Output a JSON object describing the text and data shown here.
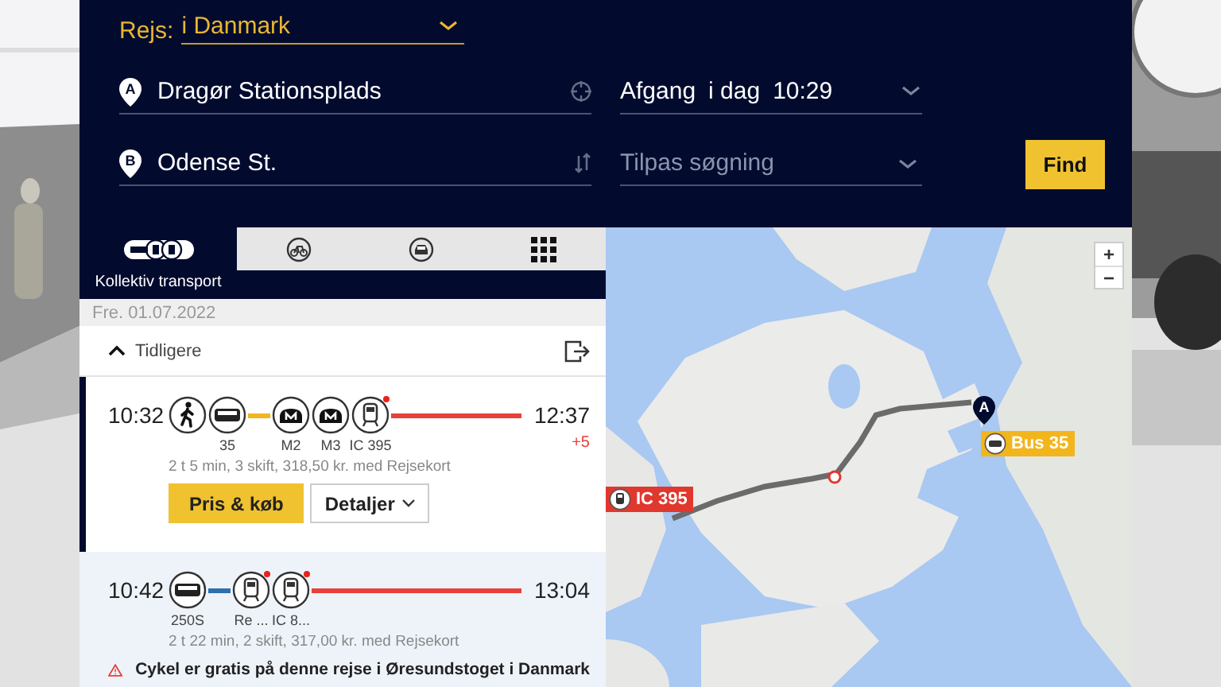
{
  "trip_type": {
    "label": "Rejs:",
    "value": "i Danmark"
  },
  "from": {
    "marker": "A",
    "value": "Dragør Stationsplads"
  },
  "to": {
    "marker": "B",
    "value": "Odense St."
  },
  "departure": {
    "mode": "Afgang",
    "day": "i dag",
    "time": "10:29"
  },
  "customize": {
    "placeholder": "Tilpas søgning"
  },
  "find_button": "Find",
  "tabs": [
    {
      "kind": "transit",
      "label": "Kollektiv transport",
      "selected": true
    },
    {
      "kind": "bike",
      "selected": false
    },
    {
      "kind": "car",
      "selected": false
    },
    {
      "kind": "more",
      "selected": false
    }
  ],
  "date": "Fre. 01.07.2022",
  "earlier": "Tidligere",
  "journeys": [
    {
      "selected": true,
      "depart": "10:32",
      "arrive": "12:37",
      "delay": "+5",
      "summary": "2 t 5 min, 3 skift, 318,50 kr. med Rejsekort",
      "legs": [
        {
          "kind": "walk",
          "alert": false
        },
        {
          "kind": "bus",
          "label": "35",
          "alert": false,
          "color": "#f2b51c"
        },
        {
          "kind": "metro",
          "label": "M2",
          "alert": false
        },
        {
          "kind": "metro",
          "label": "M3",
          "alert": false
        },
        {
          "kind": "train",
          "label": "IC 395",
          "alert": true,
          "color": "#e8403a"
        }
      ],
      "buttons": [
        {
          "kind": "primary",
          "label": "Pris & køb"
        },
        {
          "kind": "dropdown",
          "label": "Detaljer"
        }
      ]
    },
    {
      "selected": false,
      "depart": "10:42",
      "arrive": "13:04",
      "summary": "2 t 22 min, 2 skift, 317,00 kr. med Rejsekort",
      "legs": [
        {
          "kind": "bus",
          "label": "250S",
          "alert": false,
          "color": "#2f6fae"
        },
        {
          "kind": "train",
          "label": "Re ...",
          "alert": true
        },
        {
          "kind": "train",
          "label": "IC 8...",
          "alert": true,
          "color": "#e8403a"
        }
      ],
      "notice": {
        "kind": "warning",
        "text": "Cykel er gratis på denne rejse i Øresundstoget i Danmark"
      }
    }
  ],
  "map": {
    "zoom_in": "+",
    "zoom_out": "−",
    "start_marker": "A",
    "markers": [
      {
        "kind": "train",
        "label": "IC 395",
        "color": "#e0382e"
      },
      {
        "kind": "bus",
        "label": "Bus 35",
        "color": "#f2b51c"
      }
    ]
  }
}
